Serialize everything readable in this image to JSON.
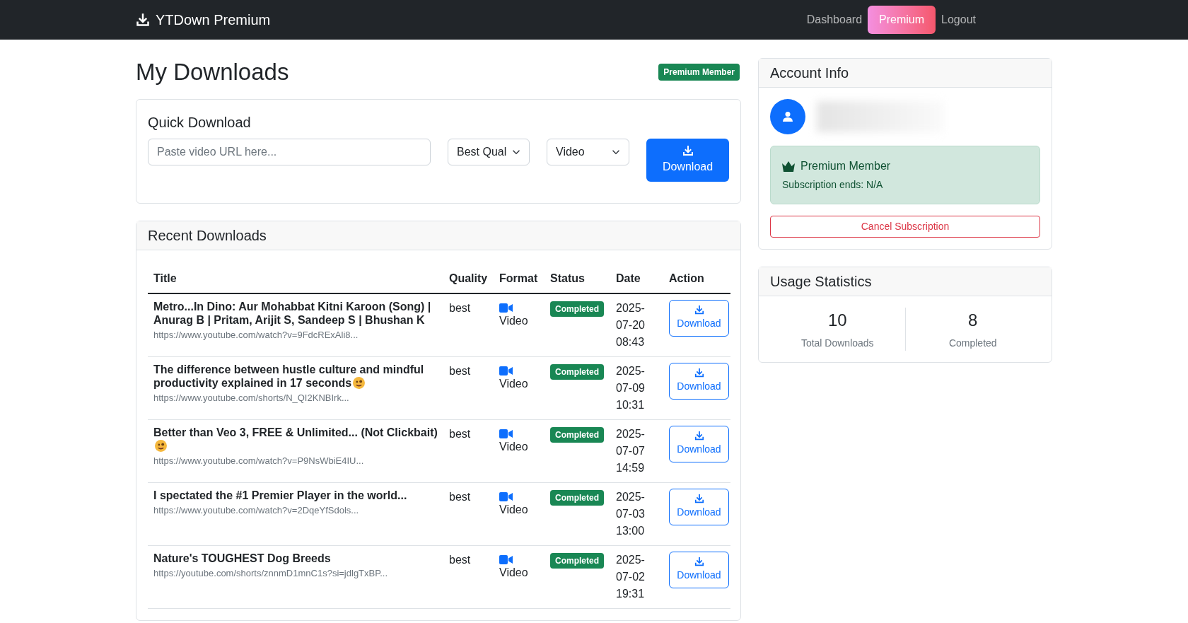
{
  "navbar": {
    "brand": "YTDown Premium",
    "links": [
      {
        "label": "Dashboard",
        "highlighted": false
      },
      {
        "label": "Premium",
        "highlighted": true
      },
      {
        "label": "Logout",
        "highlighted": false
      }
    ]
  },
  "page": {
    "title": "My Downloads",
    "badge": "Premium Member"
  },
  "quick_download": {
    "title": "Quick Download",
    "url_placeholder": "Paste video URL here...",
    "quality": "Best Qual",
    "format": "Video",
    "button": "Download"
  },
  "recent_downloads": {
    "title": "Recent Downloads",
    "columns": [
      "Title",
      "Quality",
      "Format",
      "Status",
      "Date",
      "Action"
    ],
    "rows": [
      {
        "title": "Metro...In Dino: Aur Mohabbat Kitni Karoon (Song) | Anurag B | Pritam, Arijit S, Sandeep S | Bhushan K",
        "emoji": false,
        "url": "https://www.youtube.com/watch?v=9FdcRExAli8...",
        "quality": "best",
        "format": "Video",
        "status": "Completed",
        "date": "2025-07-20 08:43",
        "action": "Download"
      },
      {
        "title": "The difference between hustle culture and mindful productivity explained in 17 seconds",
        "emoji": true,
        "url": "https://www.youtube.com/shorts/N_QI2KNBIrk...",
        "quality": "best",
        "format": "Video",
        "status": "Completed",
        "date": "2025-07-09 10:31",
        "action": "Download"
      },
      {
        "title": "Better than Veo 3, FREE & Unlimited... (Not Clickbait)",
        "emoji": true,
        "url": "https://www.youtube.com/watch?v=P9NsWbiE4IU...",
        "quality": "best",
        "format": "Video",
        "status": "Completed",
        "date": "2025-07-07 14:59",
        "action": "Download"
      },
      {
        "title": "I spectated the #1 Premier Player in the world...",
        "emoji": false,
        "url": "https://www.youtube.com/watch?v=2DqeYfSdols...",
        "quality": "best",
        "format": "Video",
        "status": "Completed",
        "date": "2025-07-03 13:00",
        "action": "Download"
      },
      {
        "title": "Nature's TOUGHEST Dog Breeds",
        "emoji": false,
        "url": "https://youtube.com/shorts/znnmD1mnC1s?si=jdlgTxBP...",
        "quality": "best",
        "format": "Video",
        "status": "Completed",
        "date": "2025-07-02 19:31",
        "action": "Download"
      }
    ]
  },
  "account": {
    "title": "Account Info",
    "membership": "Premium Member",
    "subscription": "Subscription ends: N/A",
    "cancel_button": "Cancel Subscription"
  },
  "usage": {
    "title": "Usage Statistics",
    "stats": [
      {
        "value": "10",
        "label": "Total Downloads"
      },
      {
        "value": "8",
        "label": "Completed"
      }
    ]
  }
}
